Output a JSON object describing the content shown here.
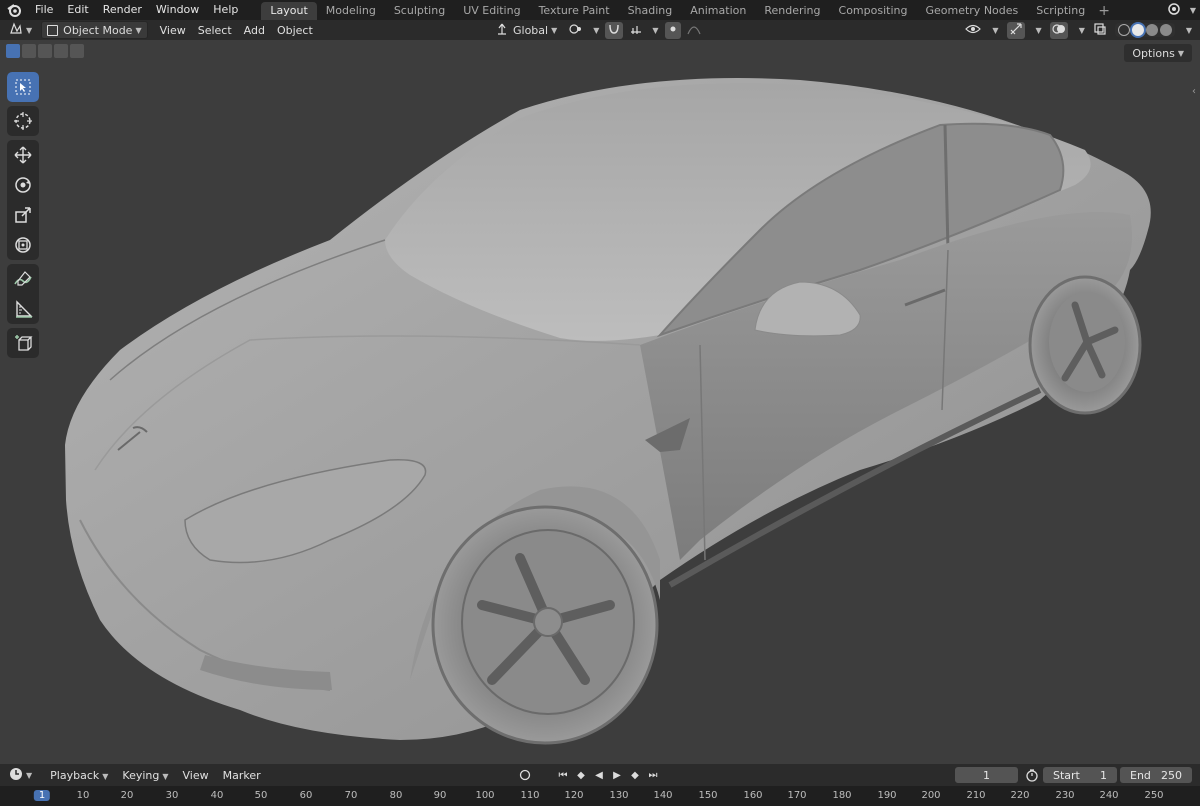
{
  "menubar": {
    "items": [
      "File",
      "Edit",
      "Render",
      "Window",
      "Help"
    ]
  },
  "workspaces": [
    "Layout",
    "Modeling",
    "Sculpting",
    "UV Editing",
    "Texture Paint",
    "Shading",
    "Animation",
    "Rendering",
    "Compositing",
    "Geometry Nodes",
    "Scripting"
  ],
  "active_workspace": "Layout",
  "header": {
    "mode": "Object Mode",
    "menus": [
      "View",
      "Select",
      "Add",
      "Object"
    ],
    "transform_orientation": "Global"
  },
  "options_label": "Options",
  "toolbar_icons": [
    "select-box-icon",
    "cursor-icon",
    "move-icon",
    "rotate-icon",
    "scale-icon",
    "transform-icon",
    "annotate-icon",
    "measure-icon",
    "add-cube-icon"
  ],
  "timeline": {
    "menus": [
      "Playback",
      "Keying",
      "View",
      "Marker"
    ],
    "current_frame": "1",
    "start_label": "Start",
    "start_value": "1",
    "end_label": "End",
    "end_value": "250"
  },
  "ruler_ticks": [
    "1",
    "10",
    "20",
    "30",
    "40",
    "50",
    "60",
    "70",
    "80",
    "90",
    "100",
    "110",
    "120",
    "130",
    "140",
    "150",
    "160",
    "170",
    "180",
    "190",
    "200",
    "210",
    "220",
    "230",
    "240",
    "250"
  ],
  "colors": {
    "accent": "#4772b3",
    "viewport_bg": "#3d3d3d",
    "topbar_bg": "#1f1f1f",
    "header_bg": "#2b2b2b"
  }
}
